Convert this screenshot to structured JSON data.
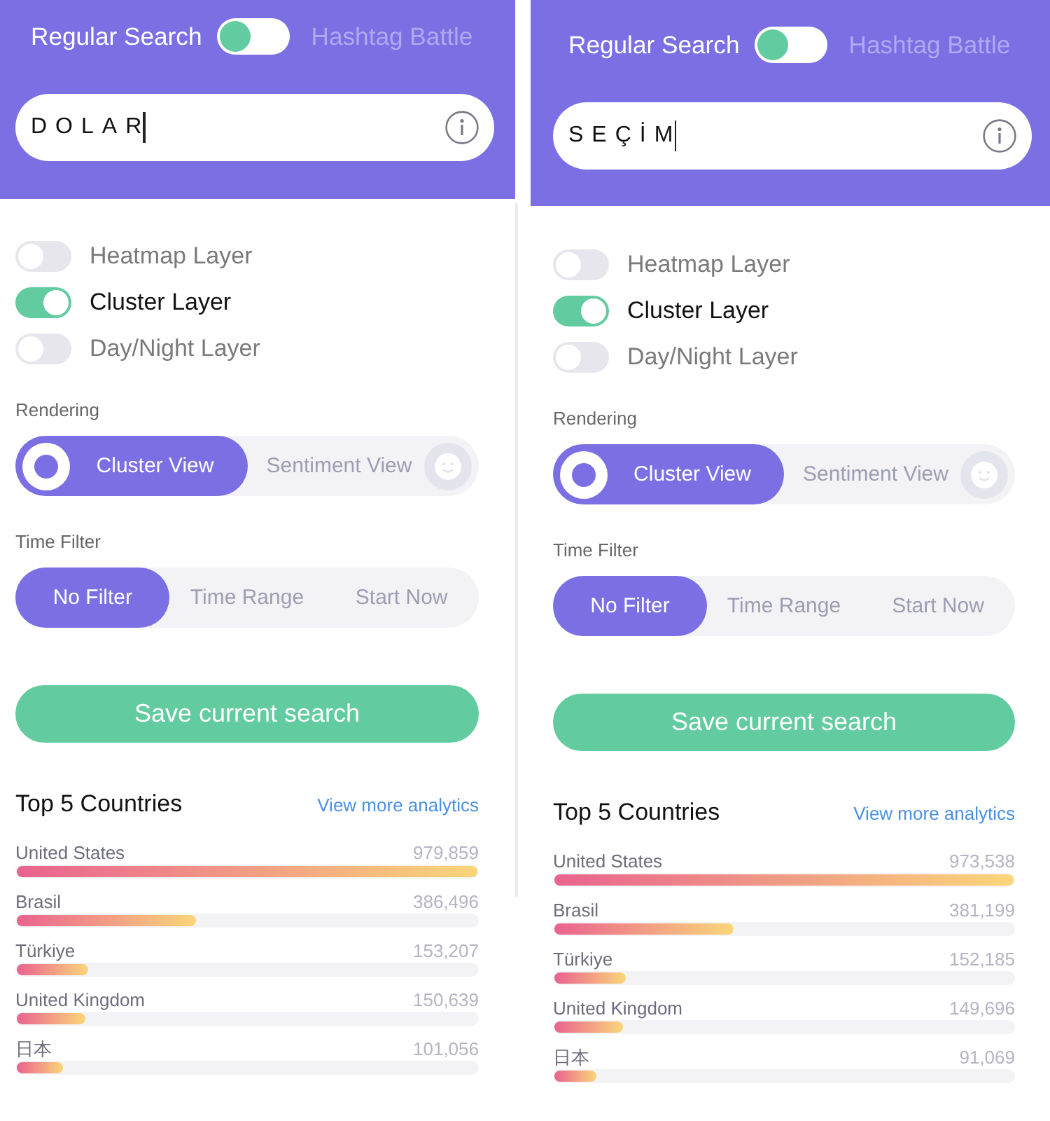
{
  "panels": [
    {
      "mode": {
        "options": [
          {
            "label": "Regular Search",
            "selected": true
          },
          {
            "label": "Hashtag Battle",
            "selected": false
          }
        ]
      },
      "search": {
        "value": "DOLAR"
      },
      "layers": [
        {
          "label": "Heatmap Layer",
          "on": false
        },
        {
          "label": "Cluster Layer",
          "on": true
        },
        {
          "label": "Day/Night Layer",
          "on": false
        }
      ],
      "rendering": {
        "label": "Rendering",
        "options": [
          {
            "label": "Cluster View",
            "kind": "cluster",
            "selected": true
          },
          {
            "label": "Sentiment View",
            "kind": "sentiment",
            "selected": false
          }
        ]
      },
      "time_filter": {
        "label": "Time Filter",
        "options": [
          {
            "label": "No Filter",
            "selected": true
          },
          {
            "label": "Time Range",
            "selected": false
          },
          {
            "label": "Start Now",
            "selected": false
          }
        ]
      },
      "save_button": {
        "label": "Save current search"
      },
      "top_countries": {
        "title": "Top 5 Countries",
        "link": "View more analytics",
        "rows": [
          {
            "name": "United States",
            "count": "979,859",
            "level": 1.0
          },
          {
            "name": "Brasil",
            "count": "386,496",
            "level": 0.39
          },
          {
            "name": "Türkiye",
            "count": "153,207",
            "level": 0.155
          },
          {
            "name": "United Kingdom",
            "count": "150,639",
            "level": 0.15
          },
          {
            "name": "日本",
            "count": "101,056",
            "level": 0.1
          }
        ]
      }
    },
    {
      "mode": {
        "options": [
          {
            "label": "Regular Search",
            "selected": true
          },
          {
            "label": "Hashtag Battle",
            "selected": false
          }
        ]
      },
      "search": {
        "value": "SEÇİM"
      },
      "layers": [
        {
          "label": "Heatmap Layer",
          "on": false
        },
        {
          "label": "Cluster Layer",
          "on": true
        },
        {
          "label": "Day/Night Layer",
          "on": false
        }
      ],
      "rendering": {
        "label": "Rendering",
        "options": [
          {
            "label": "Cluster View",
            "kind": "cluster",
            "selected": true
          },
          {
            "label": "Sentiment View",
            "kind": "sentiment",
            "selected": false
          }
        ]
      },
      "time_filter": {
        "label": "Time Filter",
        "options": [
          {
            "label": "No Filter",
            "selected": true
          },
          {
            "label": "Time Range",
            "selected": false
          },
          {
            "label": "Start Now",
            "selected": false
          }
        ]
      },
      "save_button": {
        "label": "Save current search"
      },
      "top_countries": {
        "title": "Top 5 Countries",
        "link": "View more analytics",
        "rows": [
          {
            "name": "United States",
            "count": "973,538",
            "level": 1.0
          },
          {
            "name": "Brasil",
            "count": "381,199",
            "level": 0.39
          },
          {
            "name": "Türkiye",
            "count": "152,185",
            "level": 0.155
          },
          {
            "name": "United Kingdom",
            "count": "149,696",
            "level": 0.15
          },
          {
            "name": "日本",
            "count": "91,069",
            "level": 0.09
          }
        ]
      }
    }
  ]
}
